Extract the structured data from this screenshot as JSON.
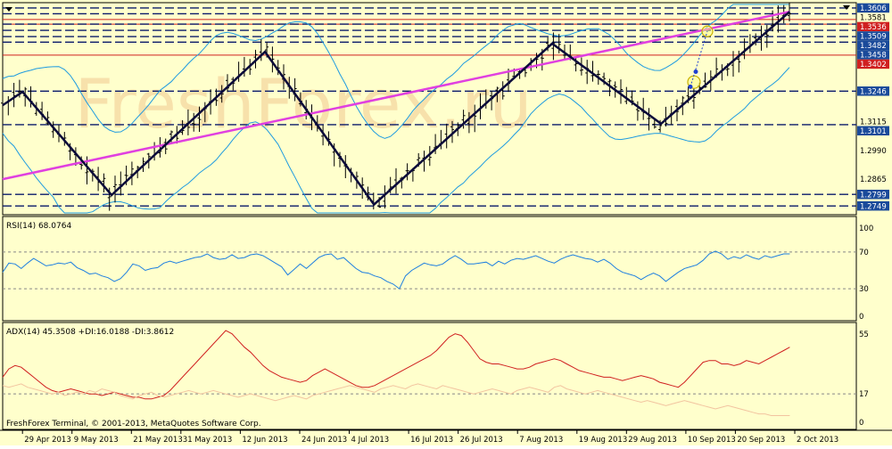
{
  "window": {
    "watermark": "FreshForex.ru",
    "copyright": "FreshForex Terminal, © 2001-2013, MetaQuotes Software Corp."
  },
  "colors": {
    "background": "#ffffcc",
    "bars": "#000000",
    "zigzag": "#0a0a3a",
    "trendline": "#e040e0",
    "bands": "#1e9be0",
    "level_line": "#0a1a6a",
    "red_level": "#d02020",
    "rsi_line": "#1e7fe0",
    "adx_line": "#d02020",
    "di_plus_line": "#f2c4a0",
    "price_tag_bg": "#1a4a9a",
    "price_tag_red_bg": "#d02020",
    "watermark": "#f0c890"
  },
  "chart_data": [
    {
      "type": "ohlc",
      "panel": "price",
      "ylim": [
        1.2715,
        1.3625
      ],
      "grid": false,
      "x_labels": [
        "29 Apr 2013",
        "9 May 2013",
        "21 May 2013",
        "31 May 2013",
        "12 Jun 2013",
        "24 Jun 2013",
        "4 Jul 2013",
        "16 Jul 2013",
        "26 Jul 2013",
        "7 Aug 2013",
        "19 Aug 2013",
        "29 Aug 2013",
        "10 Sep 2013",
        "20 Sep 2013",
        "2 Oct 2013"
      ],
      "y_ticks": [
        "1.3606",
        "1.3581",
        "1.3536",
        "1.3509",
        "1.3482",
        "1.3458",
        "1.3402",
        "1.3246",
        "1.3115",
        "1.3101",
        "1.2990",
        "1.2865",
        "1.2799",
        "1.2749"
      ],
      "levels": [
        1.3606,
        1.3581,
        1.3536,
        1.3509,
        1.3482,
        1.3458,
        1.3246,
        1.3101,
        1.2799,
        1.2749
      ],
      "red_levels": [
        1.3556,
        1.3536,
        1.3402
      ],
      "highlighted_tags": [
        "1.3606",
        "1.3536",
        "1.3509",
        "1.3482",
        "1.3458",
        "1.3402",
        "1.3246",
        "1.3101",
        "1.2799",
        "1.2749"
      ],
      "red_tags": [
        "1.3536",
        "1.3402"
      ],
      "zigzag": [
        {
          "date": "25 Apr 2013",
          "price": 1.3185
        },
        {
          "date": "29 Apr 2013",
          "price": 1.3243
        },
        {
          "date": "17 May 2013",
          "price": 1.2796
        },
        {
          "date": "17 Jun 2013",
          "price": 1.3416
        },
        {
          "date": "9 Jul 2013",
          "price": 1.2755
        },
        {
          "date": "14 Aug 2013",
          "price": 1.3452
        },
        {
          "date": "5 Sep 2013",
          "price": 1.3105
        },
        {
          "date": "1 Oct 2013",
          "price": 1.359
        }
      ],
      "trendline": [
        {
          "date": "25 Apr 2013",
          "price": 1.2865
        },
        {
          "date": "1 Oct 2013",
          "price": 1.359
        }
      ]
    },
    {
      "type": "line",
      "panel": "rsi",
      "title": "RSI(14) 68.0764",
      "ylim": [
        0,
        100
      ],
      "y_ticks": [
        "100",
        "70",
        "30",
        "0"
      ],
      "levels": [
        70,
        30
      ],
      "series": [
        {
          "name": "RSI(14)",
          "values": [
            48,
            58,
            57,
            52,
            58,
            63,
            59,
            55,
            56,
            58,
            57,
            59,
            53,
            50,
            46,
            47,
            44,
            42,
            38,
            41,
            48,
            57,
            55,
            50,
            52,
            53,
            58,
            60,
            58,
            60,
            62,
            64,
            65,
            68,
            64,
            62,
            63,
            67,
            63,
            64,
            67,
            68,
            66,
            62,
            58,
            54,
            45,
            51,
            57,
            52,
            58,
            64,
            67,
            68,
            62,
            64,
            58,
            52,
            48,
            47,
            44,
            42,
            38,
            35,
            30,
            44,
            50,
            54,
            58,
            56,
            55,
            57,
            62,
            66,
            62,
            57,
            57,
            58,
            59,
            55,
            60,
            57,
            61,
            63,
            62,
            64,
            66,
            63,
            60,
            58,
            62,
            65,
            67,
            65,
            63,
            62,
            59,
            62,
            58,
            52,
            48,
            46,
            44,
            40,
            44,
            47,
            44,
            38,
            43,
            48,
            52,
            54,
            56,
            61,
            68,
            71,
            68,
            62,
            65,
            63,
            67,
            64,
            62,
            66,
            64,
            66,
            68,
            68
          ]
        }
      ]
    },
    {
      "type": "line",
      "panel": "adx",
      "title": "ADX(14) 45.3508 +DI:16.0188 -DI:3.8612",
      "ylim": [
        0,
        55
      ],
      "y_ticks": [
        "55",
        "17",
        "0"
      ],
      "levels": [
        17
      ],
      "series": [
        {
          "name": "ADX(14)",
          "values": [
            27,
            32,
            34,
            33,
            30,
            27,
            24,
            21,
            19,
            18,
            19,
            20,
            19,
            18,
            17,
            17,
            16,
            17,
            18,
            17,
            16,
            15,
            15,
            14,
            14,
            15,
            16,
            19,
            23,
            27,
            31,
            35,
            39,
            43,
            47,
            51,
            55,
            53,
            49,
            45,
            42,
            38,
            34,
            31,
            29,
            27,
            26,
            25,
            24,
            25,
            28,
            30,
            32,
            30,
            28,
            26,
            24,
            22,
            21,
            21,
            22,
            24,
            26,
            28,
            30,
            32,
            34,
            36,
            38,
            40,
            43,
            47,
            51,
            53,
            52,
            48,
            43,
            38,
            36,
            35,
            35,
            34,
            33,
            32,
            32,
            33,
            35,
            36,
            37,
            38,
            37,
            35,
            33,
            31,
            30,
            29,
            28,
            27,
            27,
            26,
            25,
            26,
            27,
            28,
            27,
            26,
            24,
            23,
            22,
            21,
            24,
            28,
            32,
            36,
            37,
            37,
            35,
            35,
            34,
            35,
            37,
            36,
            35,
            37,
            39,
            41,
            43,
            45
          ]
        },
        {
          "name": "+DI",
          "values": [
            22,
            21,
            22,
            23,
            21,
            20,
            19,
            18,
            17,
            18,
            16,
            17,
            18,
            17,
            19,
            18,
            20,
            19,
            18,
            16,
            15,
            14,
            16,
            17,
            18,
            16,
            15,
            16,
            17,
            18,
            19,
            18,
            17,
            18,
            19,
            18,
            17,
            16,
            15,
            16,
            17,
            16,
            15,
            14,
            13,
            14,
            15,
            16,
            15,
            14,
            16,
            17,
            18,
            19,
            20,
            21,
            22,
            21,
            20,
            19,
            18,
            20,
            21,
            22,
            21,
            20,
            22,
            23,
            22,
            21,
            20,
            22,
            21,
            20,
            19,
            18,
            17,
            18,
            19,
            20,
            19,
            18,
            17,
            19,
            20,
            21,
            20,
            19,
            18,
            21,
            22,
            20,
            19,
            18,
            17,
            18,
            19,
            18,
            17,
            16,
            15,
            14,
            13,
            12,
            13,
            12,
            11,
            10,
            11,
            12,
            13,
            12,
            11,
            10,
            9,
            8,
            9,
            10,
            9,
            8,
            7,
            6,
            5,
            5,
            4,
            4,
            4,
            4
          ]
        }
      ]
    }
  ]
}
